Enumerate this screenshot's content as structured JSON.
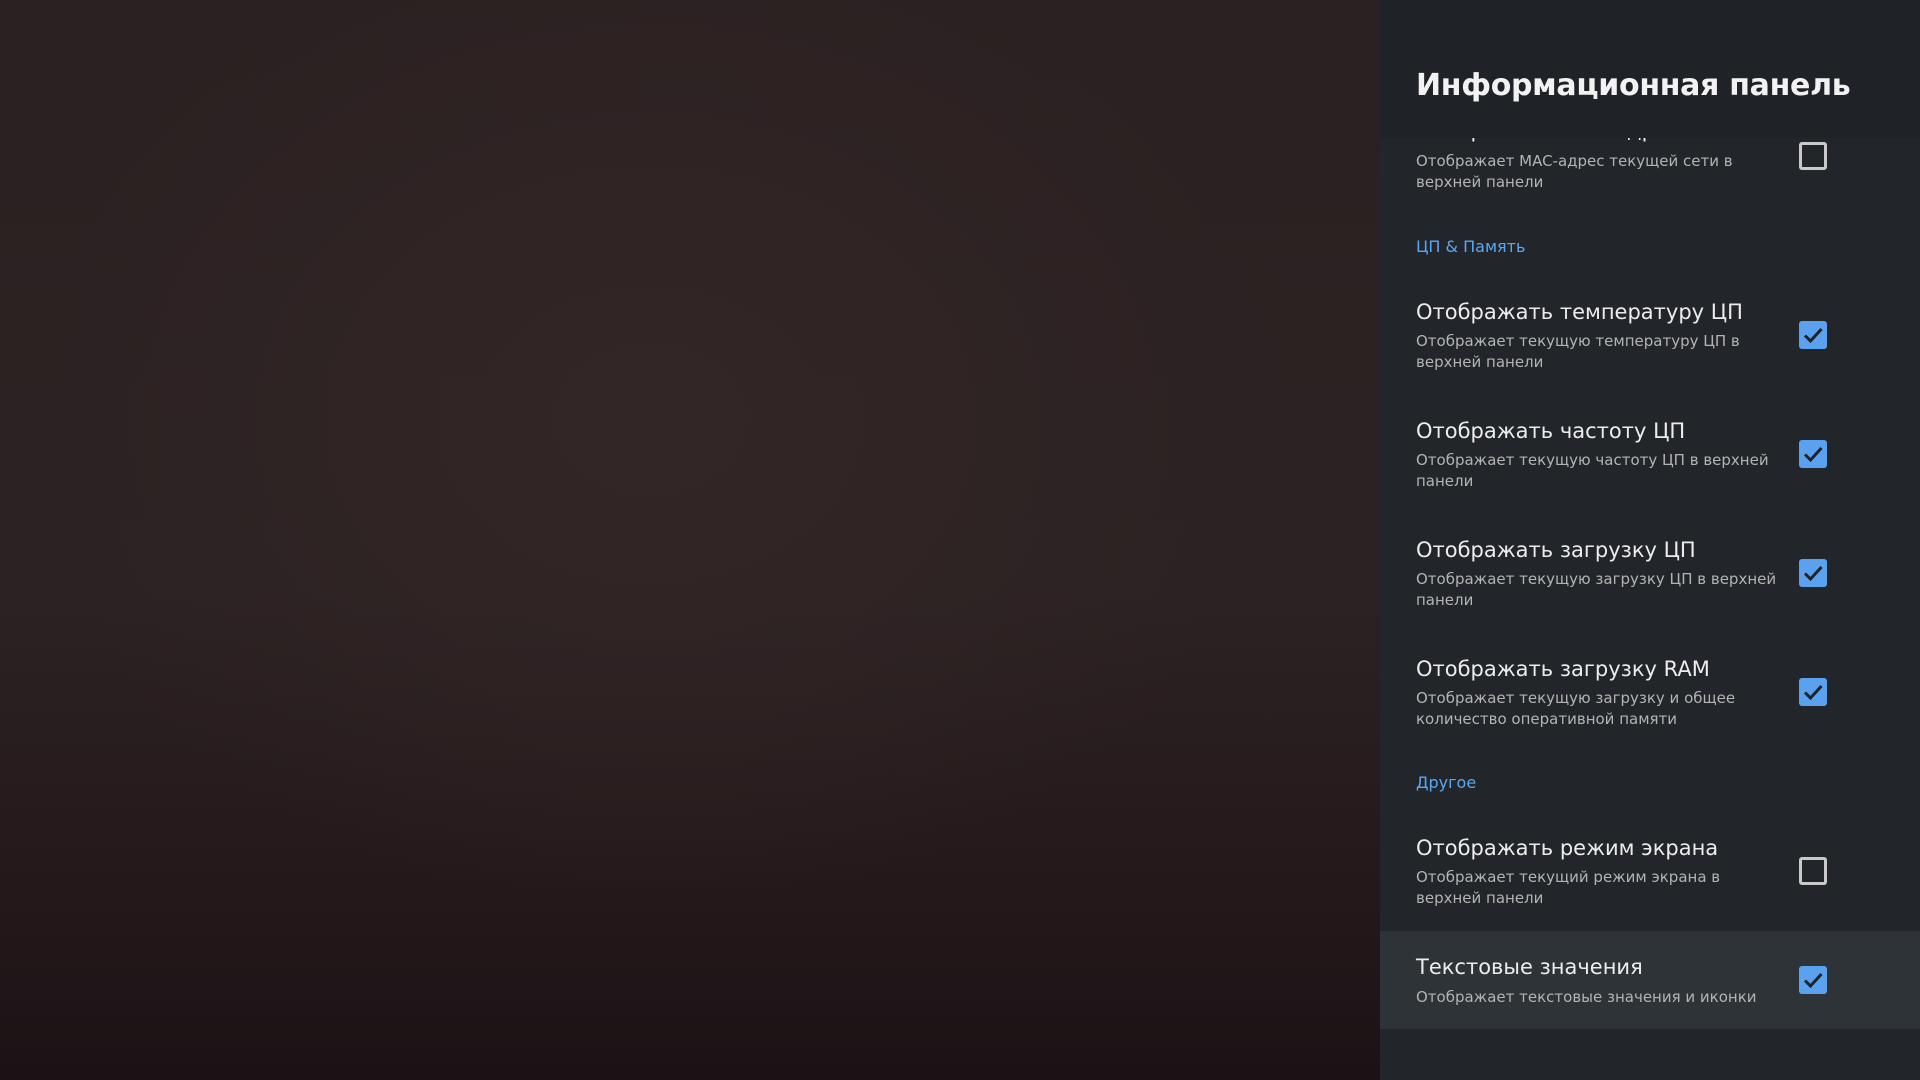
{
  "panel": {
    "title": "Информационная панель",
    "accent_color": "#5aa2f0",
    "items": [
      {
        "title": "Отображать MAC-адрес",
        "description": "Отображает MAC-адрес текущей сети в верхней панели",
        "checked": false
      },
      {
        "title": "Отображать температуру ЦП",
        "description": "Отображает текущую температуру ЦП в верхней панели",
        "checked": true
      },
      {
        "title": "Отображать частоту ЦП",
        "description": "Отображает текущую частоту ЦП в верхней панели",
        "checked": true
      },
      {
        "title": "Отображать загрузку ЦП",
        "description": "Отображает текущую загрузку ЦП в верхней панели",
        "checked": true
      },
      {
        "title": "Отображать загрузку RAM",
        "description": "Отображает текущую загрузку и общее количество оперативной памяти",
        "checked": true
      },
      {
        "title": "Отображать режим экрана",
        "description": "Отображает текущий режим экрана в верхней панели",
        "checked": false
      },
      {
        "title": "Текстовые значения",
        "description": "Отображает текстовые значения и иконки",
        "checked": true,
        "focused": true
      }
    ],
    "sections": [
      {
        "label": "ЦП & Память"
      },
      {
        "label": "Другое"
      }
    ]
  }
}
